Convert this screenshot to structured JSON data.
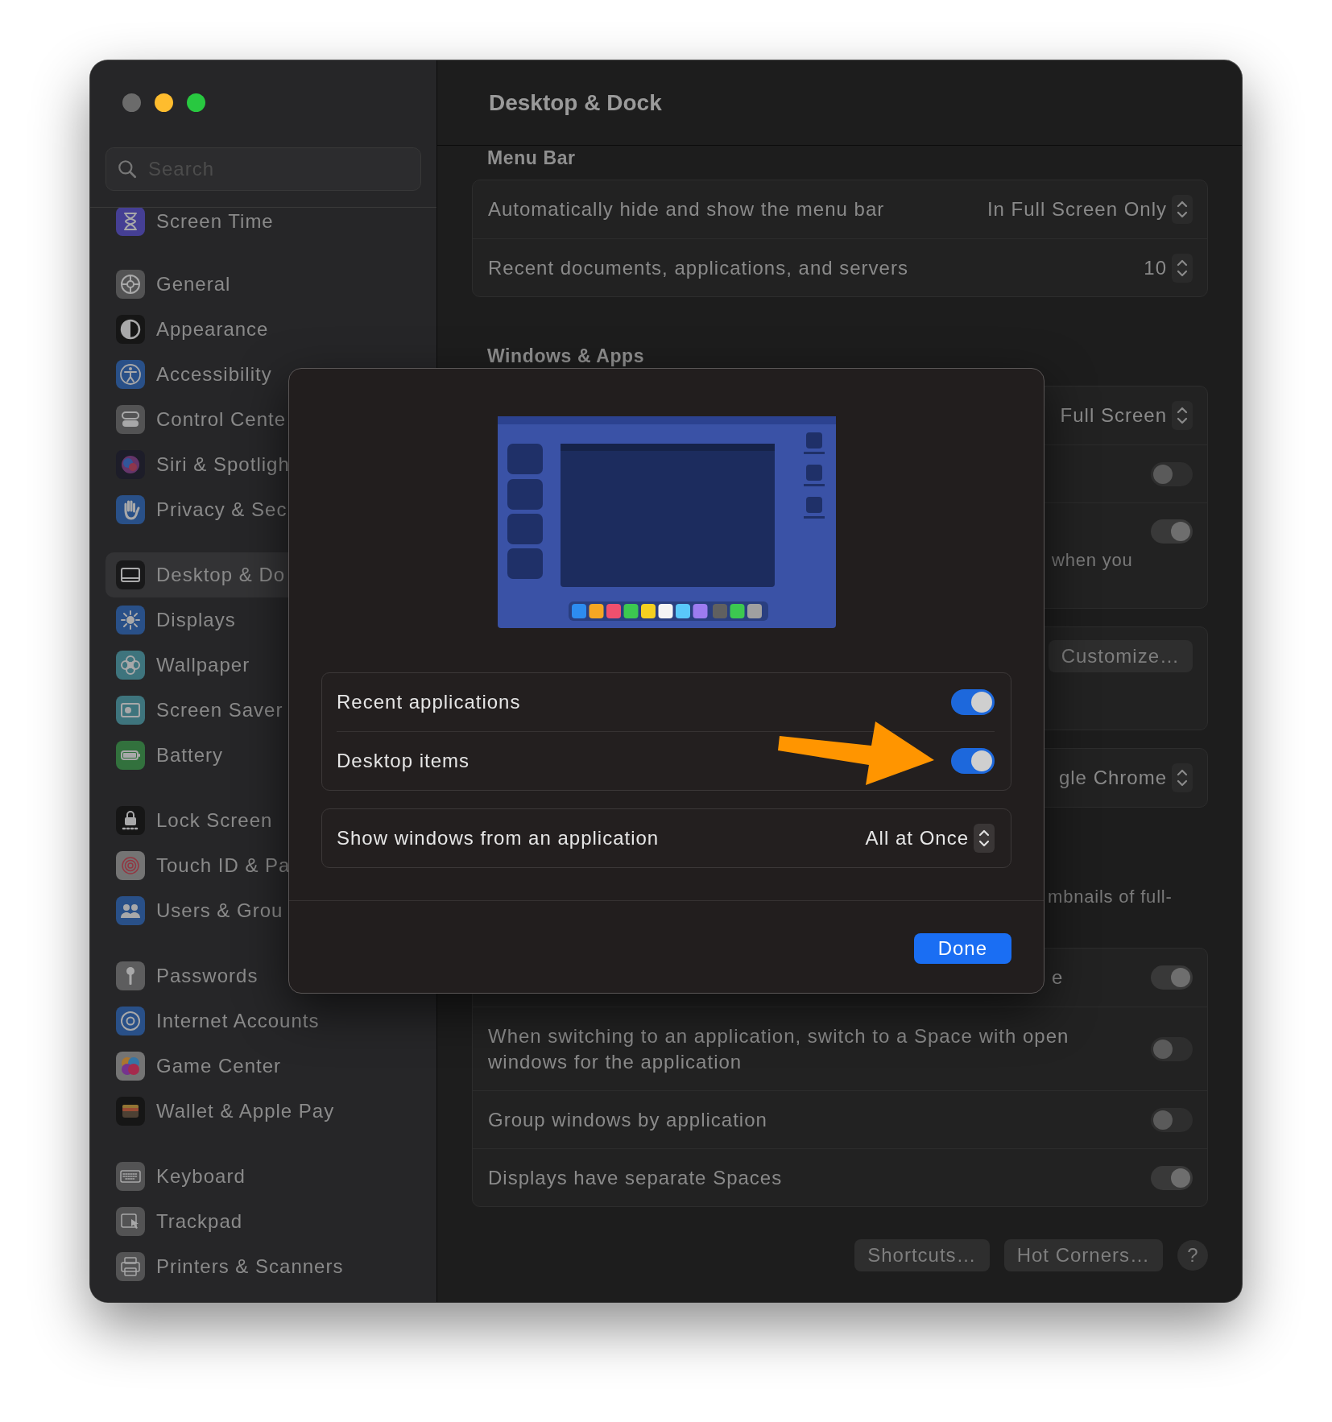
{
  "window": {
    "title": "Desktop & Dock"
  },
  "sidebar": {
    "search": {
      "placeholder": "Search"
    },
    "groups": [
      {
        "items": [
          {
            "label": "Screen Time",
            "selected": false
          }
        ]
      },
      {
        "items": [
          {
            "label": "General",
            "selected": false
          },
          {
            "label": "Appearance",
            "selected": false
          },
          {
            "label": "Accessibility",
            "selected": false
          },
          {
            "label": "Control Cente",
            "selected": false
          },
          {
            "label": "Siri & Spotligh",
            "selected": false
          },
          {
            "label": "Privacy & Sec",
            "selected": false
          }
        ]
      },
      {
        "items": [
          {
            "label": "Desktop & Do",
            "selected": true
          },
          {
            "label": "Displays",
            "selected": false
          },
          {
            "label": "Wallpaper",
            "selected": false
          },
          {
            "label": "Screen Saver",
            "selected": false
          },
          {
            "label": "Battery",
            "selected": false
          }
        ]
      },
      {
        "items": [
          {
            "label": "Lock Screen",
            "selected": false
          },
          {
            "label": "Touch ID & Pa",
            "selected": false
          },
          {
            "label": "Users & Grou",
            "selected": false
          }
        ]
      },
      {
        "items": [
          {
            "label": "Passwords",
            "selected": false
          },
          {
            "label": "Internet Accounts",
            "selected": false
          },
          {
            "label": "Game Center",
            "selected": false
          },
          {
            "label": "Wallet & Apple Pay",
            "selected": false
          }
        ]
      },
      {
        "items": [
          {
            "label": "Keyboard",
            "selected": false
          },
          {
            "label": "Trackpad",
            "selected": false
          },
          {
            "label": "Printers & Scanners",
            "selected": false
          }
        ]
      }
    ]
  },
  "content": {
    "sections": [
      {
        "heading": "Menu Bar",
        "blocks": [
          {
            "kind": "card",
            "rows": [
              {
                "kind": "popup",
                "label": "Automatically hide and show the menu bar",
                "value": "In Full Screen Only"
              },
              {
                "kind": "popup",
                "label": "Recent documents, applications, and servers",
                "value": "10"
              }
            ]
          }
        ]
      },
      {
        "heading": "Windows & Apps",
        "blocks": [
          {
            "kind": "card",
            "rows": [
              {
                "kind": "popup",
                "value": "Full Screen"
              },
              {
                "kind": "toggle",
                "on": false
              },
              {
                "kind": "toggle",
                "on": true,
                "note": "when you"
              }
            ]
          },
          {
            "kind": "card",
            "rows": [
              {
                "kind": "button",
                "value": "Customize…"
              }
            ]
          },
          {
            "kind": "card",
            "rows": [
              {
                "kind": "popup",
                "value": "gle Chrome"
              }
            ]
          },
          {
            "kind": "note",
            "text": "mbnails of full-"
          },
          {
            "kind": "card",
            "rows": [
              {
                "kind": "partial_toggle",
                "label": "e",
                "on": true
              },
              {
                "kind": "toggle",
                "label": "When switching to an application, switch to a Space with open windows for the application",
                "on": false
              },
              {
                "kind": "toggle",
                "label": "Group windows by application",
                "on": false
              },
              {
                "kind": "toggle",
                "label": "Displays have separate Spaces",
                "on": true
              }
            ]
          }
        ]
      }
    ],
    "buttons": [
      "Shortcuts…",
      "Hot Corners…"
    ],
    "help": "?"
  },
  "dialog": {
    "toggles": [
      {
        "label": "Recent applications",
        "on": true
      },
      {
        "label": "Desktop items",
        "on": true
      }
    ],
    "popup": {
      "label": "Show windows from an application",
      "value": "All at Once"
    },
    "done": "Done"
  }
}
